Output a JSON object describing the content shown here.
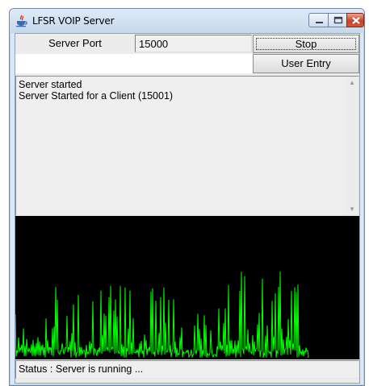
{
  "window": {
    "title": "LFSR VOIP Server",
    "icon": "java-cup-icon",
    "controls": [
      "minimize-icon",
      "maximize-icon",
      "close-icon"
    ]
  },
  "server": {
    "port_label": "Server Port",
    "port_value": "15000"
  },
  "buttons": {
    "stop_label": "Stop",
    "user_entry_label": "User Entry"
  },
  "log": {
    "lines": [
      "Server started",
      "Server Started for a Client (15001)"
    ]
  },
  "waveform": {
    "background": "#000000",
    "line_color": "#00ff00"
  },
  "status": {
    "text": "Status : Server is running ..."
  },
  "colors": {
    "window_frame": "#dbe7f3",
    "close_button": "#c7452b"
  }
}
